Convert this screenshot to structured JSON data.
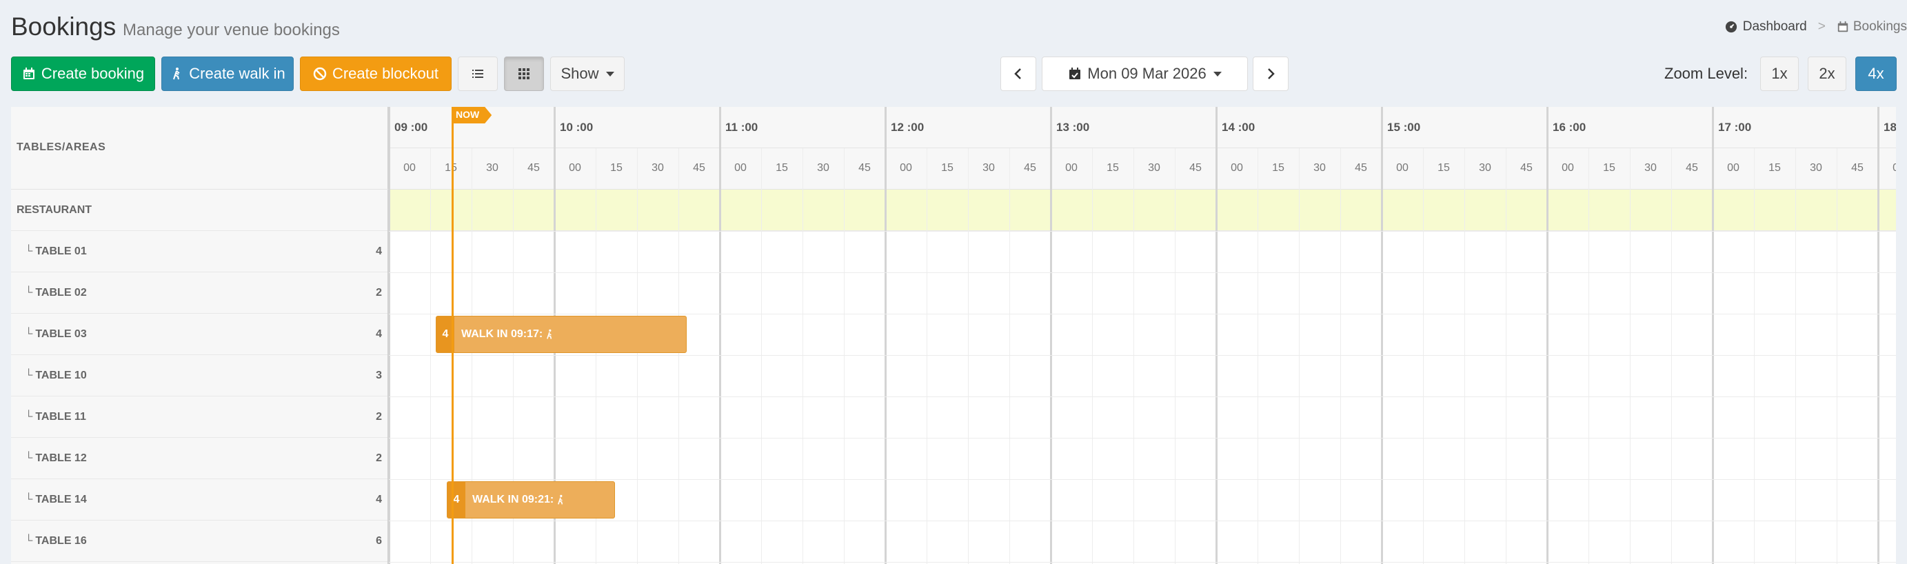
{
  "header": {
    "title": "Bookings",
    "subtitle": "Manage your venue bookings"
  },
  "breadcrumb": {
    "items": [
      {
        "label": "Dashboard",
        "icon": "dashboard-icon"
      },
      {
        "label": "Bookings",
        "icon": "calendar-icon"
      }
    ],
    "separator": ">"
  },
  "toolbar": {
    "create_booking": "Create booking",
    "create_walkin": "Create walk in",
    "create_blockout": "Create blockout",
    "show": "Show",
    "date": "Mon 09 Mar 2026",
    "zoom_label": "Zoom Level:",
    "zoom_levels": [
      "1x",
      "2x",
      "4x"
    ],
    "zoom_selected": "4x",
    "view_selected": "grid"
  },
  "colors": {
    "green": "#00a65a",
    "blue": "#3c8dbc",
    "orange": "#f39c12",
    "area_band": "#f7fbd0",
    "booking": "#edae5a"
  },
  "schedule": {
    "column_header": "TABLES/AREAS",
    "now_label": "NOW",
    "hours": [
      "09 :00",
      "10 :00",
      "11 :00",
      "12 :00",
      "13 :00",
      "14 :00",
      "15 :00",
      "16 :00",
      "17 :00",
      "18"
    ],
    "minutes": [
      "00",
      "15",
      "30",
      "45"
    ],
    "area": "RESTAURANT",
    "tables": [
      {
        "name": "TABLE 01",
        "capacity": "4"
      },
      {
        "name": "TABLE 02",
        "capacity": "2"
      },
      {
        "name": "TABLE 03",
        "capacity": "4"
      },
      {
        "name": "TABLE 10",
        "capacity": "3"
      },
      {
        "name": "TABLE 11",
        "capacity": "2"
      },
      {
        "name": "TABLE 12",
        "capacity": "2"
      },
      {
        "name": "TABLE 14",
        "capacity": "4"
      },
      {
        "name": "TABLE 16",
        "capacity": "6"
      }
    ],
    "bookings": [
      {
        "table": "TABLE 03",
        "covers": "4",
        "label": "WALK IN 09:17:",
        "start": "09:17",
        "end": "10:48"
      },
      {
        "table": "TABLE 14",
        "covers": "4",
        "label": "WALK IN 09:21:",
        "start": "09:21",
        "end": "10:22"
      }
    ],
    "now_time": "09:23"
  }
}
